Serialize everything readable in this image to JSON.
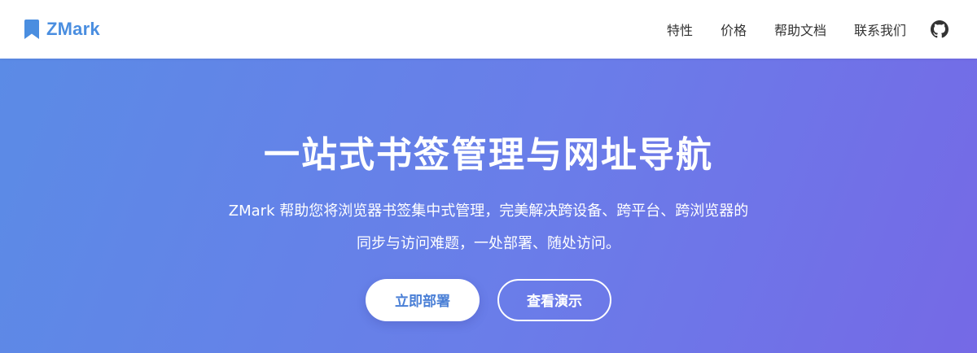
{
  "header": {
    "brand": {
      "name": "ZMark",
      "icon": "bookmark-icon",
      "color": "#4a8ee0"
    },
    "nav": {
      "features": "特性",
      "pricing": "价格",
      "docs": "帮助文档",
      "contact": "联系我们",
      "github_icon": "github-icon"
    }
  },
  "hero": {
    "title": "一站式书签管理与网址导航",
    "subtitle": "ZMark 帮助您将浏览器书签集中式管理，完美解决跨设备、跨平台、跨浏览器的同步与访问难题，一处部署、随处访问。",
    "buttons": {
      "deploy": "立即部署",
      "demo": "查看演示"
    },
    "gradient": [
      "#5b8be6",
      "#7569e6"
    ]
  }
}
